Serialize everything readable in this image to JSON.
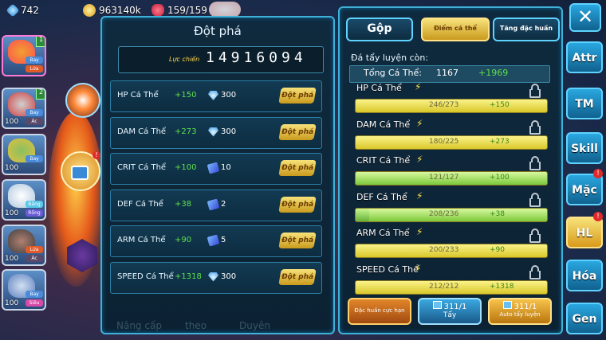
{
  "top": {
    "gems": "742",
    "gold": "963140k",
    "energy": "159/159"
  },
  "roster": [
    {
      "level": "",
      "star": "1",
      "tags": [
        "Bay",
        "Lửa"
      ]
    },
    {
      "level": "100",
      "star": "2",
      "tags": [
        "Bay",
        "Ác"
      ]
    },
    {
      "level": "100",
      "star": "",
      "tags": [
        "Bay"
      ]
    },
    {
      "level": "100",
      "star": "",
      "tags": [
        "Băng",
        "Rồng"
      ]
    },
    {
      "level": "100",
      "star": "",
      "tags": [
        "Lửa",
        "Ác"
      ]
    },
    {
      "level": "100",
      "star": "",
      "tags": [
        "Bay",
        "Siêu"
      ]
    }
  ],
  "bg_labels": {
    "a": "Nâng cấp",
    "b": "theo",
    "c": "Duyên"
  },
  "breakthrough": {
    "title": "Đột phá",
    "power_label": "Lực chiến",
    "power_value": "14916094",
    "rows": [
      {
        "name": "HP Cá Thể",
        "bonus": "+150",
        "cost": "300",
        "currency": "gem-icon",
        "button": "Đột phá"
      },
      {
        "name": "DAM Cá Thể",
        "bonus": "+273",
        "cost": "300",
        "currency": "gem-icon",
        "button": "Đột phá"
      },
      {
        "name": "CRIT Cá Thể",
        "bonus": "+100",
        "cost": "10",
        "currency": "ticket-icon",
        "button": "Đột phá"
      },
      {
        "name": "DEF Cá Thể",
        "bonus": "+38",
        "cost": "2",
        "currency": "ticket-icon",
        "button": "Đột phá"
      },
      {
        "name": "ARM Cá Thể",
        "bonus": "+90",
        "cost": "5",
        "currency": "ticket-icon",
        "button": "Đột phá"
      },
      {
        "name": "SPEED Cá Thể",
        "bonus": "+1318",
        "cost": "300",
        "currency": "gem-icon",
        "button": "Đột phá"
      }
    ]
  },
  "stats_panel": {
    "tabs": {
      "merge": "Gộp",
      "points": "Điểm cá thể",
      "specialty": "Tăng đặc huấn"
    },
    "wash_label": "Đá tẩy luyện còn:",
    "total_label": "Tổng Cá Thể:",
    "total_value": "1167",
    "total_bonus": "+1969",
    "stats": [
      {
        "name": "HP Cá Thể",
        "current": 246,
        "max": 273,
        "text": "246/273",
        "bonus": "+150"
      },
      {
        "name": "DAM Cá Thể",
        "current": 180,
        "max": 225,
        "text": "180/225",
        "bonus": "+273"
      },
      {
        "name": "CRIT Cá Thể",
        "current": 121,
        "max": 127,
        "text": "121/127",
        "bonus": "+100"
      },
      {
        "name": "DEF Cá Thể",
        "current": 208,
        "max": 236,
        "text": "208/236",
        "bonus": "+38"
      },
      {
        "name": "ARM Cá Thể",
        "current": 200,
        "max": 233,
        "text": "200/233",
        "bonus": "+90"
      },
      {
        "name": "SPEED Cá Thể",
        "current": 212,
        "max": 212,
        "text": "212/212",
        "bonus": "+1318"
      }
    ],
    "buttons": {
      "limit": "Đặc huấn cực hạn",
      "wash_count": "311/1",
      "wash": "Tẩy",
      "auto_count": "311/1",
      "auto": "Auto tẩy luyện"
    }
  },
  "side_menu": [
    "Attr",
    "TM",
    "Skill",
    "Mặc",
    "HL",
    "Hóa",
    "Gen"
  ],
  "colors": {
    "accent": "#3fb0d8",
    "gold": "#e2b83a",
    "green": "#5fe04a"
  }
}
